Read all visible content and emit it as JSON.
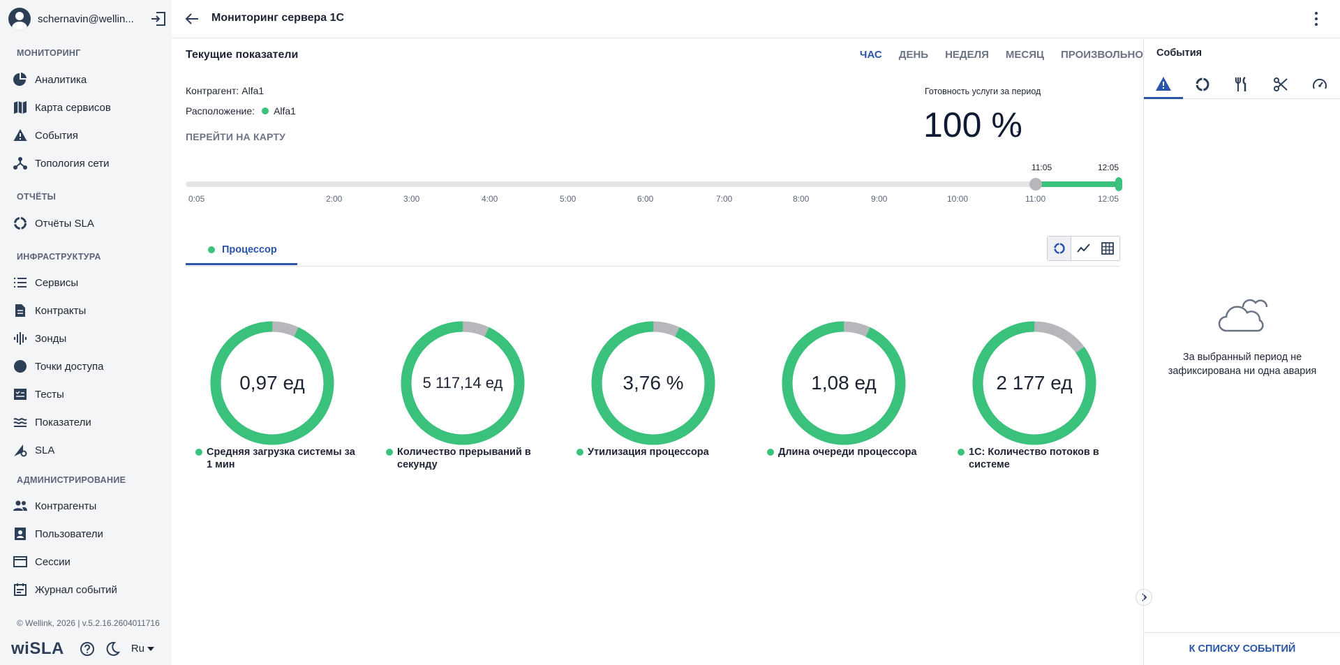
{
  "user": {
    "name": "schernavin@wellin..."
  },
  "sidebar": {
    "sections": [
      {
        "title": "МОНИТОРИНГ",
        "items": [
          "Аналитика",
          "Карта сервисов",
          "События",
          "Топология сети"
        ]
      },
      {
        "title": "ОТЧЁТЫ",
        "items": [
          "Отчёты SLA"
        ]
      },
      {
        "title": "ИНФРАСТРУКТУРА",
        "items": [
          "Сервисы",
          "Контракты",
          "Зонды",
          "Точки доступа",
          "Тесты",
          "Показатели",
          "SLA"
        ]
      },
      {
        "title": "АДМИНИСТРИРОВАНИЕ",
        "items": [
          "Контрагенты",
          "Пользователи",
          "Сессии",
          "Журнал событий"
        ]
      }
    ],
    "copyright": "© Wellink, 2026 | v.5.2.16.2604011716",
    "logo": "wiSLA",
    "language": "Ru"
  },
  "header": {
    "title": "Мониторинг сервера 1С"
  },
  "main": {
    "title": "Текущие показатели",
    "periods": [
      "ЧАС",
      "ДЕНЬ",
      "НЕДЕЛЯ",
      "МЕСЯЦ",
      "ПРОИЗВОЛЬНО"
    ],
    "active_period": "ЧАС",
    "counterparty_label": "Контрагент:",
    "counterparty_value": "Alfa1",
    "location_label": "Расположение:",
    "location_value": "Alfa1",
    "map_link": "ПЕРЕЙТИ НА КАРТУ",
    "availability_label": "Готовность услуги за период",
    "availability_value": "100 %",
    "availability_dash": "-",
    "timeline": {
      "ticks": [
        "0:05",
        "2:00",
        "3:00",
        "4:00",
        "5:00",
        "6:00",
        "7:00",
        "8:00",
        "9:00",
        "10:00",
        "11:00",
        "12:05"
      ],
      "range_start": "11:05",
      "range_end": "12:05"
    },
    "tab": "Процессор",
    "gauges": [
      {
        "value": "0,97 ед",
        "label": "Средняя загрузка системы за 1 мин",
        "fill": 0.93
      },
      {
        "value": "5 117,14 ед",
        "label": "Количество прерываний в секунду",
        "fill": 0.93
      },
      {
        "value": "3,76 %",
        "label": "Утилизация процессора",
        "fill": 0.93
      },
      {
        "value": "1,08 ед",
        "label": "Длина очереди процессора",
        "fill": 0.93
      },
      {
        "value": "2 177 ед",
        "label": "1С: Количество потоков в системе",
        "fill": 0.85
      }
    ],
    "colors": {
      "accent": "#2a55a8",
      "ok": "#3ac27c",
      "rest": "#b5b7ba"
    }
  },
  "events": {
    "title": "События",
    "empty_text": "За выбранный период не зафиксирована ни одна авария",
    "footer": "К СПИСКУ СОБЫТИЙ"
  }
}
